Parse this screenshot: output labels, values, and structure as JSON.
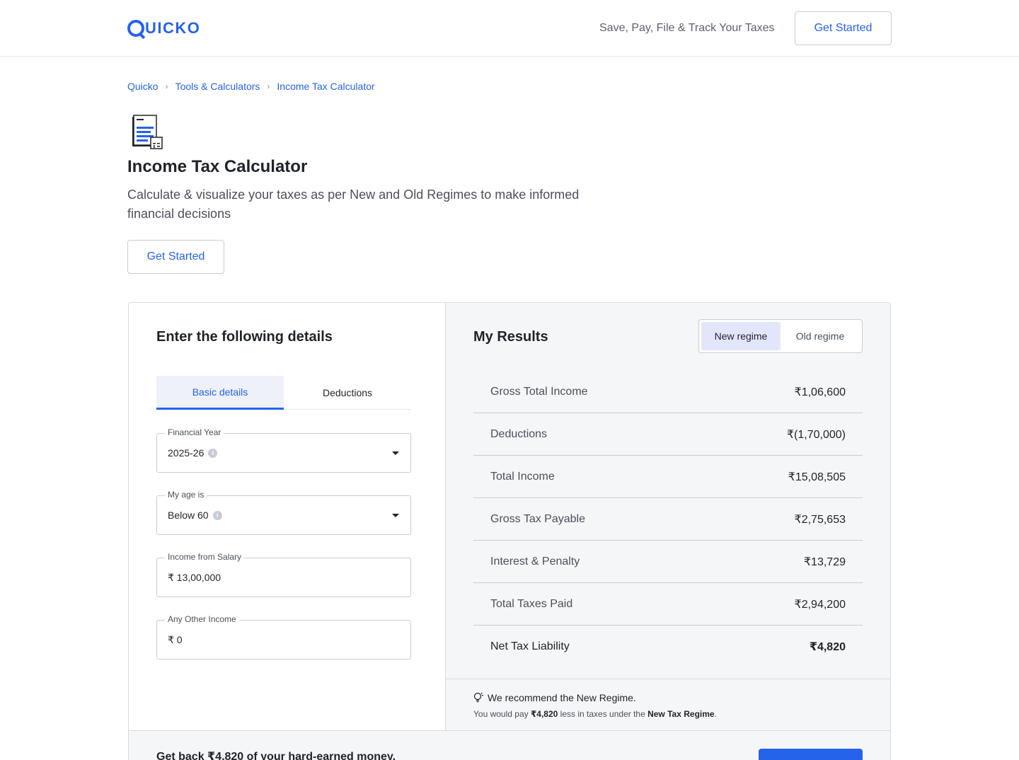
{
  "header": {
    "logo_text": "UICKO",
    "tagline": "Save, Pay, File & Track Your Taxes",
    "cta_label": "Get Started"
  },
  "breadcrumb": {
    "items": [
      "Quicko",
      "Tools & Calculators",
      "Income Tax Calculator"
    ],
    "separator": "›"
  },
  "hero": {
    "icon": "tax-document-icon",
    "title": "Income Tax Calculator",
    "subtitle": "Calculate & visualize your taxes as per New and Old Regimes to make informed financial decisions",
    "cta_label": "Get Started"
  },
  "form": {
    "title": "Enter the following details",
    "tabs": [
      {
        "label": "Basic details",
        "active": true
      },
      {
        "label": "Deductions",
        "active": false
      }
    ],
    "fields": [
      {
        "label": "Financial Year",
        "value": "2025-26",
        "info": "i",
        "type": "select"
      },
      {
        "label": "My age is",
        "value": "Below 60",
        "info": "i",
        "type": "select"
      },
      {
        "label": "Income from Salary",
        "value": "₹ 13,00,000",
        "type": "input"
      },
      {
        "label": "Any Other Income",
        "value": "₹ 0",
        "type": "input"
      }
    ]
  },
  "results": {
    "title": "My Results",
    "regimes": [
      {
        "label": "New regime",
        "active": true
      },
      {
        "label": "Old regime",
        "active": false
      }
    ],
    "rows": [
      {
        "label": "Gross Total Income",
        "value": "₹1,06,600"
      },
      {
        "label": "Deductions",
        "value": "₹(1,70,000)"
      },
      {
        "label": "Total Income",
        "value": "₹15,08,505"
      },
      {
        "label": "Gross Tax Payable",
        "value": "₹2,75,653"
      },
      {
        "label": "Interest & Penalty",
        "value": "₹13,729"
      },
      {
        "label": "Total Taxes Paid",
        "value": "₹2,94,200"
      },
      {
        "label": "Net Tax Liability",
        "value": "₹4,820"
      }
    ],
    "recommendation": {
      "headline": "We recommend the New Regime.",
      "prefix": "You would pay ",
      "amount": "₹4,820",
      "middle": " less in taxes under the ",
      "regime": "New Tax Regime",
      "suffix": "."
    }
  },
  "banner": {
    "text": "Get back ₹4,820 of your hard-earned money."
  },
  "colors": {
    "accent": "#2563eb",
    "panel_bg": "#f5f6f8",
    "toggle_active": "#e3e6fb"
  }
}
